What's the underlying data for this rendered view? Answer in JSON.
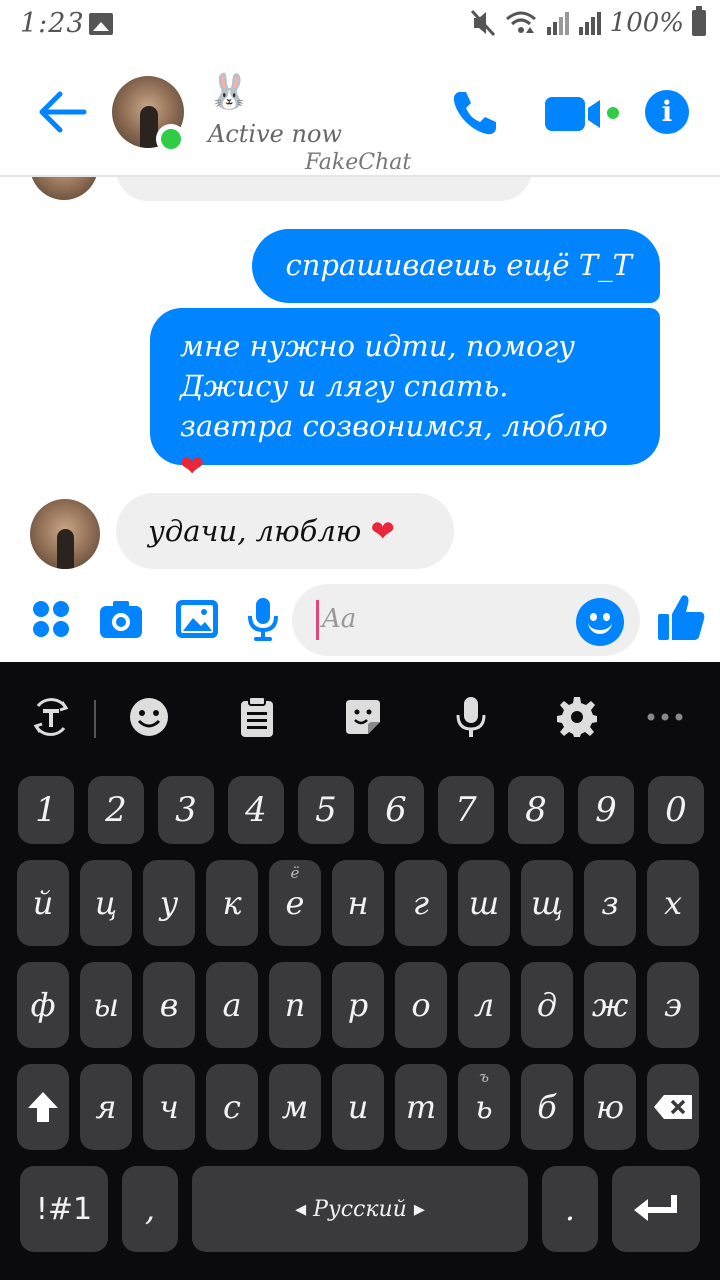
{
  "status_bar": {
    "time": "1:23",
    "battery": "100%"
  },
  "header": {
    "contact_emoji": "🐰",
    "status": "Active now",
    "watermark": "FakeChat"
  },
  "messages": [
    {
      "direction": "out",
      "text": "спрашиваешь ещё Т_Т"
    },
    {
      "direction": "out",
      "text": "мне нужно идти, помогу Джису и лягу спать. завтра созвонимся, люблю",
      "emoji": "❤"
    },
    {
      "direction": "in",
      "text": "удачи, люблю",
      "emoji": "❤"
    }
  ],
  "composer": {
    "placeholder": "Aa"
  },
  "keyboard": {
    "number_row": [
      "1",
      "2",
      "3",
      "4",
      "5",
      "6",
      "7",
      "8",
      "9",
      "0"
    ],
    "row1": [
      "й",
      "ц",
      "у",
      "к",
      "е",
      "н",
      "г",
      "ш",
      "щ",
      "з",
      "х"
    ],
    "row1_hints": {
      "е": "ё"
    },
    "row2": [
      "ф",
      "ы",
      "в",
      "а",
      "п",
      "р",
      "о",
      "л",
      "д",
      "ж",
      "э"
    ],
    "row3": [
      "я",
      "ч",
      "с",
      "м",
      "и",
      "т",
      "ь",
      "б",
      "ю"
    ],
    "row3_hints": {
      "ь": "ъ"
    },
    "symbols_key": "!#1",
    "comma_key": ",",
    "space_label": "◂ Русский ▸",
    "period_key": "."
  },
  "colors": {
    "accent": "#0084ff",
    "online": "#31cc46",
    "outgoing_bubble": "#0084ff",
    "incoming_bubble": "#efefef",
    "keyboard_bg": "#0b0b0d",
    "key_bg": "#3a3a3c"
  }
}
